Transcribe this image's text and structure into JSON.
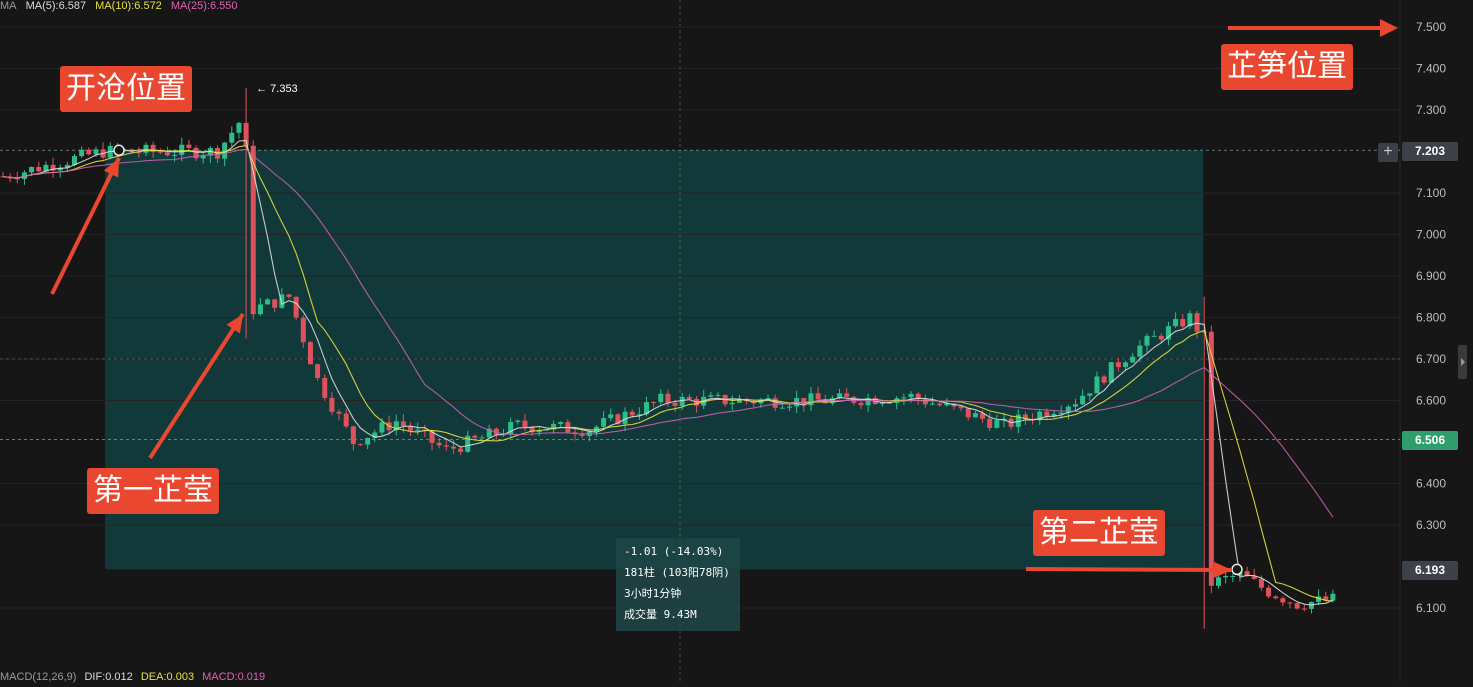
{
  "ma_legend": {
    "indicator": "MA",
    "ma5": "MA(5):6.587",
    "ma10": "MA(10):6.572",
    "ma25": "MA(25):6.550",
    "colors": {
      "indicator": "#9a9a9a",
      "ma5": "#dcdcdc",
      "ma10": "#e6e040",
      "ma25": "#e060b8"
    }
  },
  "macd_legend": {
    "macd": "MACD(12,26,9)",
    "dif": "DIF:0.012",
    "dea": "DEA:0.003",
    "value": "MACD:0.019",
    "colors": {
      "macd": "#9a9a9a",
      "dif": "#dcdcdc",
      "dea": "#e6e040",
      "value": "#e060b8"
    }
  },
  "annotations": {
    "open_position": "开沧位置",
    "first_pin": "第一芷莹",
    "second_pin": "第二芷莹",
    "bamboo_position": "芷笋位置",
    "high_label": "← 7.353"
  },
  "measure_box": {
    "change": "-1.01 (-14.03%)",
    "bars": "181柱 (103阳78阴)",
    "duration": "3小时1分钟",
    "volume": "成交量 9.43M"
  },
  "price_tags": {
    "upper": "7.203",
    "current": "6.506",
    "lower": "6.193",
    "upper_color": "#3d4149",
    "current_color": "#2e9e6c",
    "lower_color": "#3d4149"
  },
  "plus_button": "+",
  "colors": {
    "background": "#161616",
    "up_candle": "#2dbd8a",
    "down_candle": "#e0525b",
    "measure_fill": "#124040",
    "arrow": "#e9472f",
    "grid": "#242424",
    "axis_text": "#bdbdbd"
  },
  "chart_data": {
    "type": "candlestick",
    "y_axis": {
      "ylim": [
        6.015,
        7.547
      ],
      "ticks": [
        "7.500",
        "7.400",
        "7.300",
        "7.100",
        "7.000",
        "6.900",
        "6.800",
        "6.700",
        "6.600",
        "6.400",
        "6.300",
        "6.100"
      ]
    },
    "bars_total": 181,
    "bars_up": 103,
    "bars_down": 78,
    "keypoints": [
      {
        "bar": 0,
        "price": 7.14
      },
      {
        "bar": 14,
        "price": 7.2
      },
      {
        "bar": 30,
        "price": 7.2
      },
      {
        "bar": 33,
        "price": 7.27
      },
      {
        "bar": 34,
        "price": 7.2
      },
      {
        "bar": 35,
        "price": 6.82
      },
      {
        "bar": 40,
        "price": 6.85
      },
      {
        "bar": 44,
        "price": 6.65
      },
      {
        "bar": 49,
        "price": 6.5
      },
      {
        "bar": 55,
        "price": 6.55
      },
      {
        "bar": 62,
        "price": 6.48
      },
      {
        "bar": 72,
        "price": 6.54
      },
      {
        "bar": 82,
        "price": 6.53
      },
      {
        "bar": 92,
        "price": 6.6
      },
      {
        "bar": 102,
        "price": 6.6
      },
      {
        "bar": 115,
        "price": 6.6
      },
      {
        "bar": 127,
        "price": 6.61
      },
      {
        "bar": 140,
        "price": 6.54
      },
      {
        "bar": 150,
        "price": 6.6
      },
      {
        "bar": 158,
        "price": 6.72
      },
      {
        "bar": 166,
        "price": 6.8
      },
      {
        "bar": 168,
        "price": 6.75
      },
      {
        "bar": 169,
        "price": 6.16
      },
      {
        "bar": 173,
        "price": 6.18
      },
      {
        "bar": 177,
        "price": 6.14
      },
      {
        "bar": 181,
        "price": 6.11
      },
      {
        "bar": 186,
        "price": 6.12
      }
    ],
    "spikes": [
      {
        "bar": 34,
        "high": 7.353,
        "low": 6.75
      },
      {
        "bar": 168,
        "high": 6.85,
        "low": 6.05
      }
    ],
    "measure": {
      "start_price": 7.203,
      "end_price": 6.193,
      "start_bar": 14,
      "end_bar": 168,
      "change": -1.01,
      "change_pct": -14.03
    },
    "current_price": 6.506
  }
}
